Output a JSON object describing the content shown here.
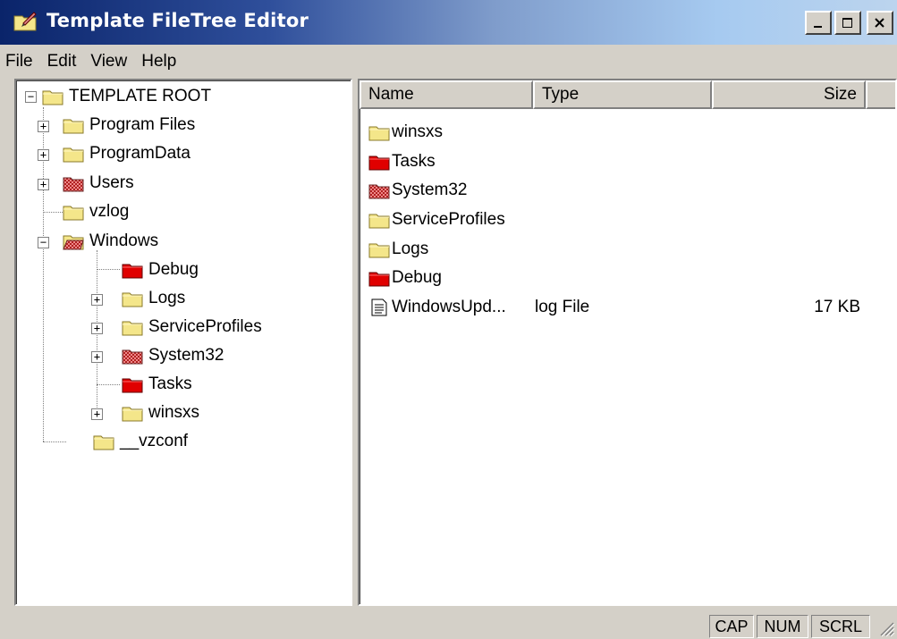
{
  "window": {
    "title": "Template FileTree Editor",
    "buttons": {
      "minimize": "_",
      "maximize": "□",
      "close": "X"
    }
  },
  "menu": [
    "File",
    "Edit",
    "View",
    "Help"
  ],
  "colors": {
    "folder_yellow": "#f4e68a",
    "folder_red": "#e00000",
    "folder_pattern": "#c84848",
    "selection_frame": "#000000"
  },
  "tree": {
    "root": "TEMPLATE ROOT",
    "items": [
      {
        "label": "Program Files",
        "icon": "folder-yellow",
        "expander": "+"
      },
      {
        "label": "ProgramData",
        "icon": "folder-yellow",
        "expander": "+"
      },
      {
        "label": "Users",
        "icon": "folder-patterned",
        "expander": "+"
      },
      {
        "label": "vzlog",
        "icon": "folder-yellow",
        "expander": ""
      },
      {
        "label": "Windows",
        "icon": "folder-open-patterned",
        "expander": "−"
      },
      {
        "label": "Debug",
        "icon": "folder-red",
        "expander": ""
      },
      {
        "label": "Logs",
        "icon": "folder-yellow",
        "expander": "+"
      },
      {
        "label": "ServiceProfiles",
        "icon": "folder-yellow",
        "expander": "+"
      },
      {
        "label": "System32",
        "icon": "folder-patterned",
        "expander": "+"
      },
      {
        "label": "Tasks",
        "icon": "folder-red",
        "expander": ""
      },
      {
        "label": "winsxs",
        "icon": "folder-yellow",
        "expander": "+"
      },
      {
        "label": "__vzconf",
        "icon": "folder-yellow",
        "expander": ""
      }
    ]
  },
  "list": {
    "columns": {
      "name": "Name",
      "type": "Type",
      "size": "Size"
    },
    "rows": [
      {
        "name": "winsxs",
        "type": "",
        "size": "",
        "icon": "folder-yellow"
      },
      {
        "name": "Tasks",
        "type": "",
        "size": "",
        "icon": "folder-red"
      },
      {
        "name": "System32",
        "type": "",
        "size": "",
        "icon": "folder-patterned"
      },
      {
        "name": "ServiceProfiles",
        "type": "",
        "size": "",
        "icon": "folder-yellow"
      },
      {
        "name": "Logs",
        "type": "",
        "size": "",
        "icon": "folder-yellow"
      },
      {
        "name": "Debug",
        "type": "",
        "size": "",
        "icon": "folder-red"
      },
      {
        "name": "WindowsUpd...",
        "type": "log File",
        "size": "17 KB",
        "icon": "document"
      }
    ]
  },
  "status": {
    "cap": "CAP",
    "num": "NUM",
    "scrl": "SCRL"
  }
}
